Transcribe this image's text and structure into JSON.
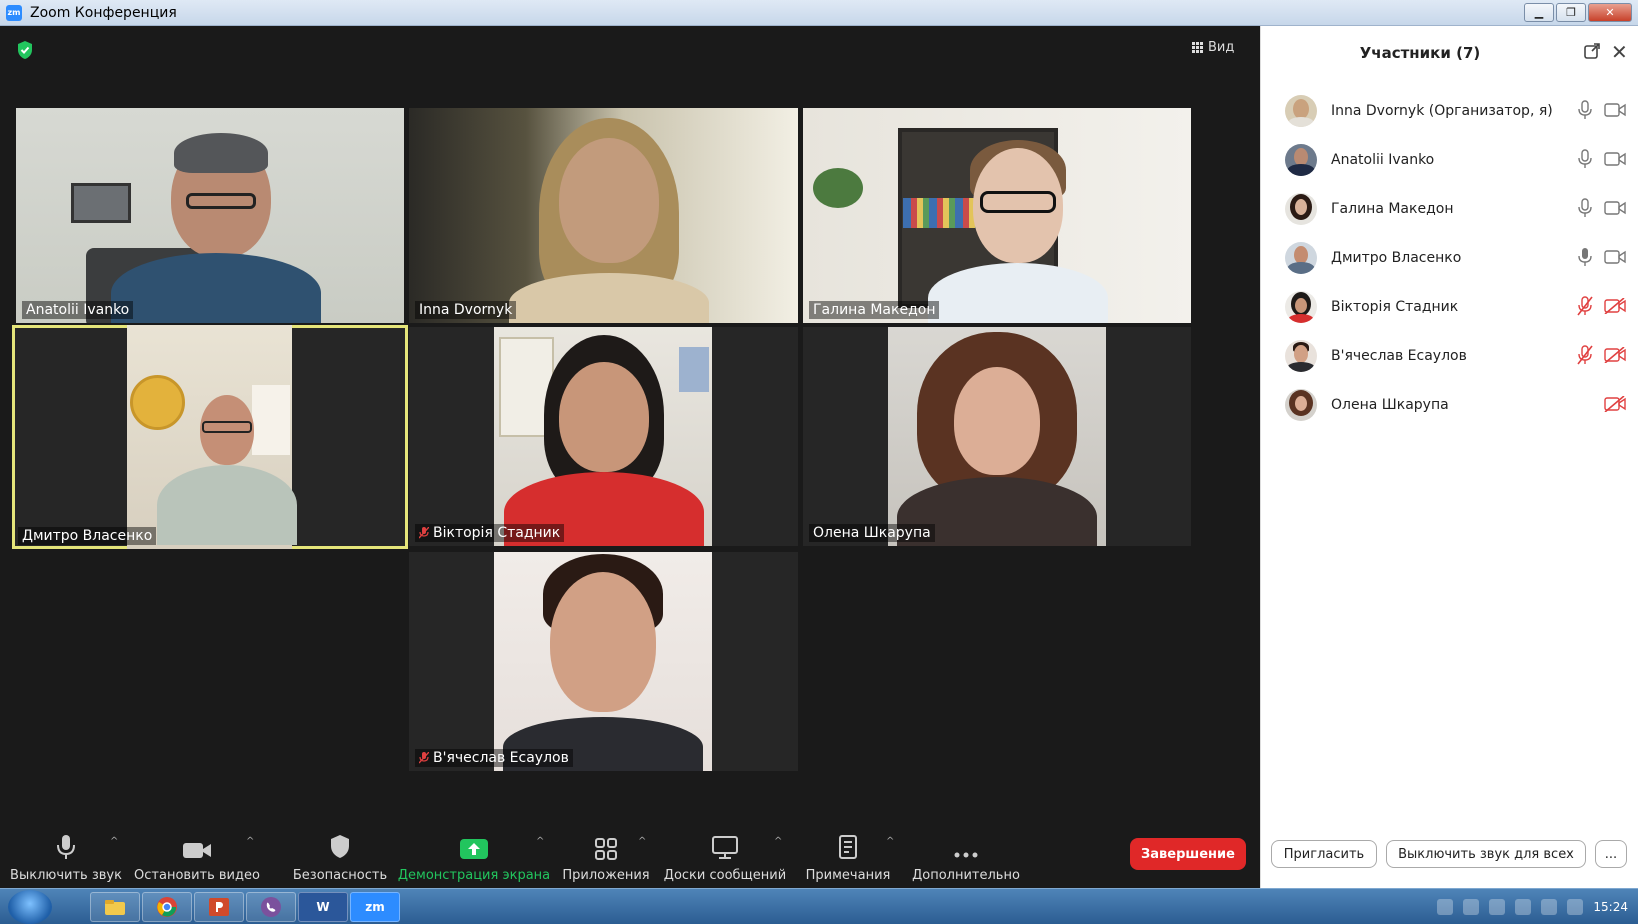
{
  "window": {
    "title": "Zoom Конференция",
    "logo": "zm",
    "buttons": [
      "minimize",
      "maximize",
      "close"
    ]
  },
  "view_button": {
    "label": "Вид",
    "icon": "grid-icon"
  },
  "tiles": [
    {
      "name": "Anatolii Ivanko",
      "muted": false,
      "active": false
    },
    {
      "name": "Inna Dvornyk",
      "muted": false,
      "active": false
    },
    {
      "name": "Галина Македон",
      "muted": false,
      "active": false
    },
    {
      "name": "Дмитро Власенко",
      "muted": false,
      "active": true
    },
    {
      "name": "Вікторія Стадник",
      "muted": true,
      "active": false
    },
    {
      "name": "Олена Шкарупа",
      "muted": false,
      "active": false
    },
    {
      "name": "В'ячеслав Есаулов",
      "muted": true,
      "active": false
    }
  ],
  "toolbar": {
    "mute_label": "Выключить звук",
    "video_label": "Остановить видео",
    "security_label": "Безопасность",
    "share_label": "Демонстрация экрана",
    "apps_label": "Приложения",
    "whiteboard_label": "Доски сообщений",
    "notes_label": "Примечания",
    "more_label": "Дополнительно",
    "end_label": "Завершение"
  },
  "participants_panel": {
    "title": "Участники (7)",
    "participants": [
      {
        "name": "Inna Dvornyk (Организатор, я)",
        "mic": "on",
        "cam": "on"
      },
      {
        "name": "Anatolii Ivanko",
        "mic": "on",
        "cam": "on"
      },
      {
        "name": "Галина Македон",
        "mic": "on",
        "cam": "on"
      },
      {
        "name": "Дмитро Власенко",
        "mic": "active",
        "cam": "on"
      },
      {
        "name": "Вікторія Стадник",
        "mic": "muted",
        "cam": "off"
      },
      {
        "name": "В'ячеслав Есаулов",
        "mic": "muted",
        "cam": "off"
      },
      {
        "name": "Олена Шкарупа",
        "mic": "none",
        "cam": "off"
      }
    ],
    "invite_label": "Пригласить",
    "mute_all_label": "Выключить звук для всех",
    "more_label": "..."
  },
  "taskbar": {
    "apps": [
      "explorer",
      "chrome",
      "powerpoint",
      "viber",
      "word",
      "zoom"
    ],
    "word_label": "W",
    "zoom_label": "zm",
    "clock": "15:24"
  },
  "colors": {
    "accent": "#2d8cff",
    "end": "#e02828",
    "active_speaker": "#e5e57a",
    "share_green": "#22c55e",
    "muted_red": "#e04040"
  }
}
